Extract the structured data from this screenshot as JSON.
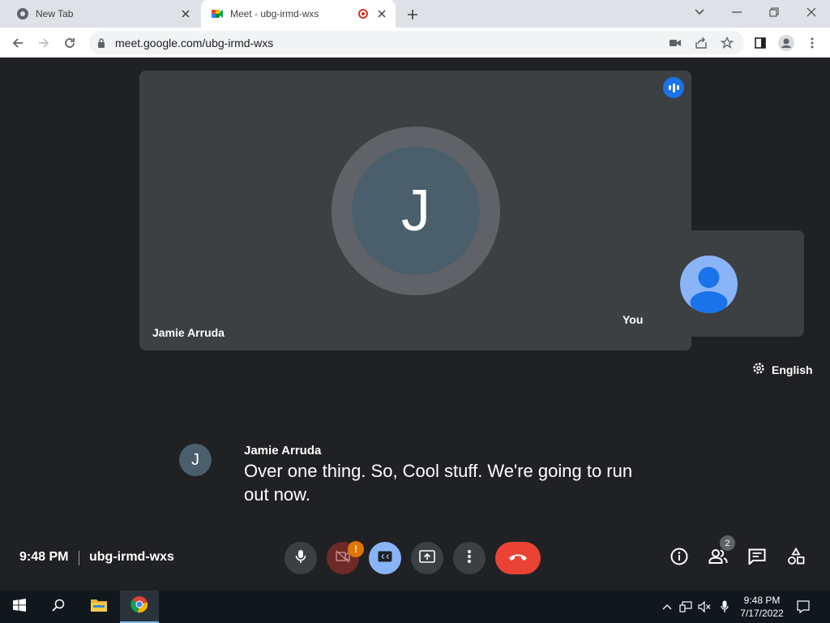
{
  "browser": {
    "tabs": [
      {
        "title": "New Tab"
      },
      {
        "title": "Meet - ubg-irmd-wxs"
      }
    ],
    "url": "meet.google.com/ubg-irmd-wxs"
  },
  "meeting": {
    "main_participant": {
      "initial": "J",
      "name": "Jamie Arruda"
    },
    "self_label": "You",
    "caption_language": "English",
    "caption": {
      "initial": "J",
      "speaker": "Jamie Arruda",
      "text": "Over one thing. So, Cool stuff. We're going to run out now."
    },
    "time": "9:48 PM",
    "code": "ubg-irmd-wxs",
    "camera_warning": "!",
    "people_count": "2"
  },
  "taskbar": {
    "time": "9:48 PM",
    "date": "7/17/2022"
  },
  "colors": {
    "background": "#202124",
    "tile": "#3c4043",
    "end_call": "#ea4335",
    "cc_active": "#8ab4f8",
    "speaking": "#1a73e8"
  }
}
